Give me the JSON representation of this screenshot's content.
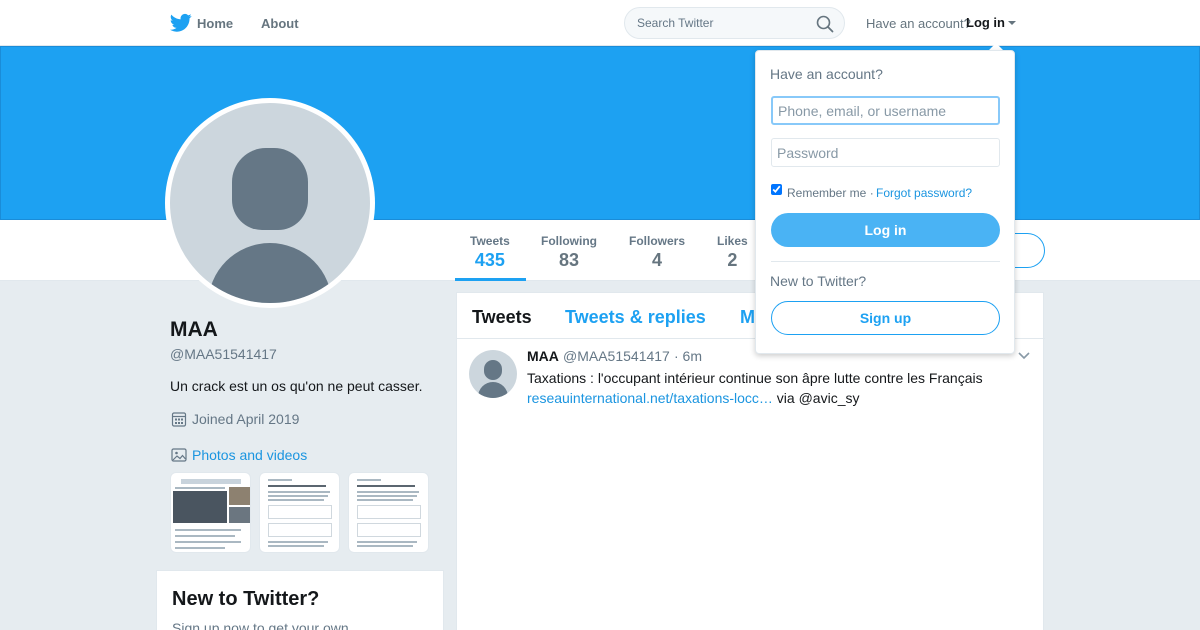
{
  "topbar": {
    "home_label": "Home",
    "about_label": "About",
    "search_placeholder": "Search Twitter",
    "have_account": "Have an account?",
    "login_label": "Log in"
  },
  "profile": {
    "name": "MAA",
    "handle": "@MAA51541417",
    "bio": "Un crack est un os qu'on ne peut casser.",
    "joined": "Joined April 2019",
    "photos_label": "Photos and videos"
  },
  "stats": [
    {
      "label": "Tweets",
      "value": "435"
    },
    {
      "label": "Following",
      "value": "83"
    },
    {
      "label": "Followers",
      "value": "4"
    },
    {
      "label": "Likes",
      "value": "2"
    }
  ],
  "timeline": {
    "tabs": [
      "Tweets",
      "Tweets & replies",
      "M"
    ],
    "tweet": {
      "name": "MAA",
      "handle": "@MAA51541417",
      "time": "· 6m",
      "text": "Taxations : l'occupant intérieur continue son âpre lutte contre les Français",
      "link": "reseauinternational.net/taxations-locc…",
      "via": " via @avic_sy"
    }
  },
  "new_to_twitter": {
    "title": "New to Twitter?",
    "subtitle": "Sign up now to get your own"
  },
  "login_dropdown": {
    "title": "Have an account?",
    "username_placeholder": "Phone, email, or username",
    "password_placeholder": "Password",
    "remember": "Remember me ·",
    "forgot": "Forgot password?",
    "login_button": "Log in",
    "new_to_twitter": "New to Twitter?",
    "signup_button": "Sign up"
  },
  "colors": {
    "brand": "#1da1f2",
    "banner": "#1da1f2",
    "login_button": "#4ab3f4"
  }
}
